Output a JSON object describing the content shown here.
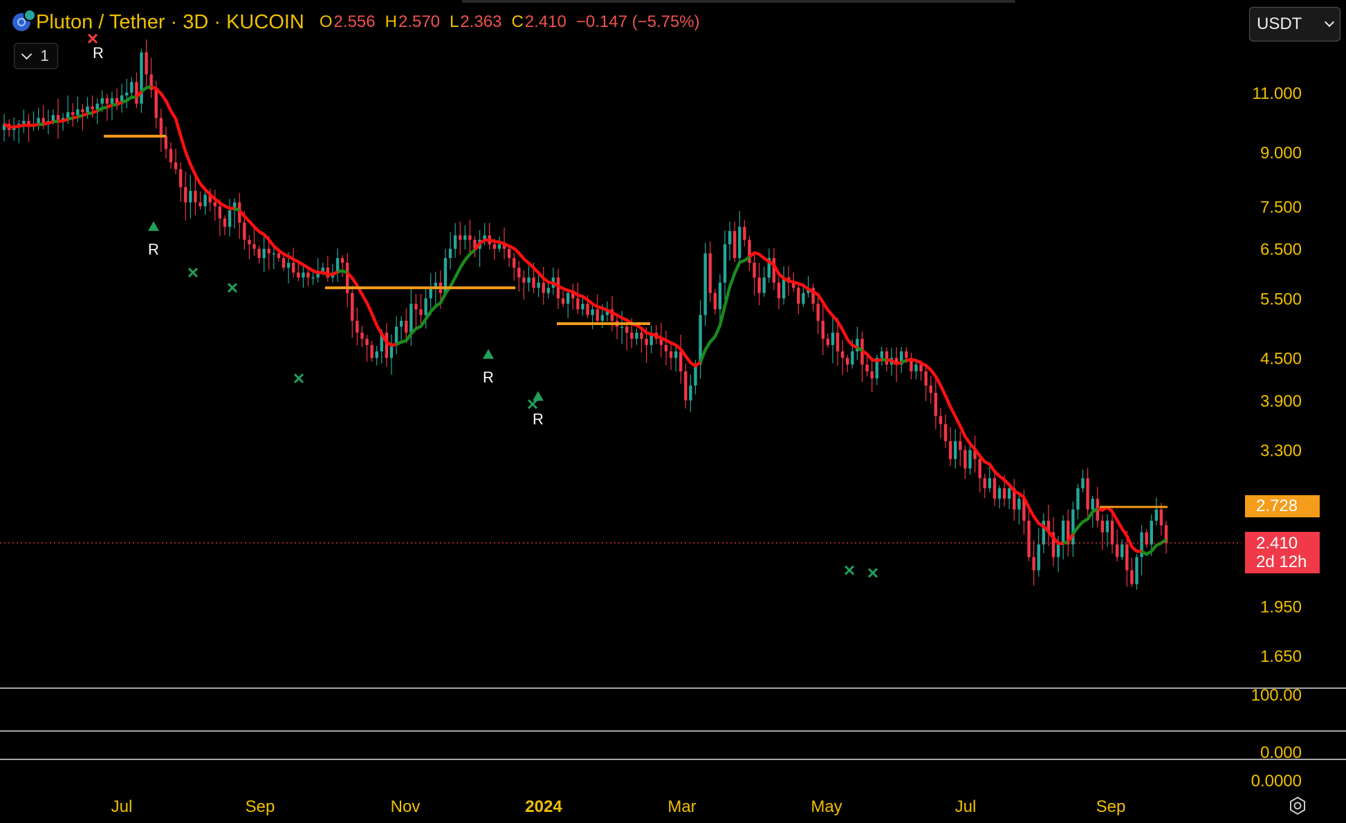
{
  "header": {
    "title": "Pluton / Tether · 3D · KUCOIN",
    "ohlc": [
      {
        "key": "O",
        "value": "2.556"
      },
      {
        "key": "H",
        "value": "2.570"
      },
      {
        "key": "L",
        "value": "2.363"
      },
      {
        "key": "C",
        "value": "2.410"
      }
    ],
    "change": "−0.147 (−5.75%)",
    "collapse_count": "1"
  },
  "currency_select": "USDT",
  "tags": {
    "orange_value": "2.728",
    "last_price": "2.410",
    "countdown": "2d 12h"
  },
  "colors": {
    "up": "#26a69a",
    "down": "#f23645",
    "ma_red": "#ff1010",
    "ma_green": "#1b8a1b",
    "ma_orange": "#f59c1a",
    "axis_text": "#f0c000"
  },
  "chart_data": {
    "type": "candlestick",
    "title": "Pluton / Tether · 3D · KUCOIN",
    "price_axis_scale": "log",
    "price_ticks": [
      11.0,
      9.0,
      7.5,
      6.5,
      5.5,
      4.5,
      3.9,
      3.3,
      1.95,
      1.65
    ],
    "price_tick_labels": [
      "11.000",
      "9.000",
      "7.500",
      "6.500",
      "5.500",
      "4.500",
      "3.900",
      "3.300",
      "1.950",
      "1.650"
    ],
    "indicator_tick_labels": [
      "100.00",
      "0.000",
      "0.0000"
    ],
    "x_labels": [
      "Jul",
      "Sep",
      "Nov",
      "2024",
      "Mar",
      "May",
      "Jul",
      "Sep"
    ],
    "last_price": 2.41,
    "resistance_level": 2.728,
    "closes": [
      9.9,
      9.7,
      9.8,
      9.9,
      10.0,
      9.8,
      9.9,
      10.1,
      9.9,
      10.0,
      10.2,
      10.0,
      10.1,
      10.3,
      10.2,
      10.4,
      10.3,
      10.5,
      10.4,
      10.6,
      10.8,
      10.6,
      10.8,
      10.6,
      10.9,
      11.0,
      11.4,
      10.6,
      12.6,
      11.7,
      11.1,
      10.1,
      9.5,
      9.1,
      8.7,
      8.5,
      8.0,
      7.6,
      7.9,
      7.6,
      7.5,
      7.8,
      7.6,
      7.5,
      7.2,
      7.0,
      7.4,
      7.6,
      7.1,
      6.7,
      6.6,
      6.5,
      6.3,
      6.5,
      6.4,
      6.4,
      6.3,
      6.1,
      6.2,
      6.0,
      5.9,
      6.0,
      5.9,
      5.9,
      6.0,
      6.1,
      5.9,
      6.0,
      6.3,
      6.2,
      5.6,
      5.1,
      4.9,
      4.8,
      4.7,
      4.5,
      4.6,
      4.9,
      4.5,
      4.7,
      5.0,
      5.1,
      4.9,
      5.4,
      5.3,
      5.2,
      5.5,
      5.7,
      5.8,
      5.6,
      6.3,
      6.5,
      6.8,
      6.7,
      6.8,
      6.7,
      6.5,
      6.7,
      6.8,
      6.6,
      6.5,
      6.6,
      6.5,
      6.3,
      6.1,
      5.9,
      5.8,
      5.9,
      5.7,
      5.8,
      5.6,
      5.7,
      5.9,
      5.5,
      5.4,
      5.6,
      5.5,
      5.3,
      5.4,
      5.2,
      5.3,
      5.1,
      5.2,
      5.3,
      5.1,
      5.0,
      5.0,
      4.9,
      4.8,
      4.9,
      4.8,
      4.7,
      4.9,
      4.8,
      4.7,
      4.6,
      4.5,
      4.6,
      4.3,
      3.9,
      4.1,
      4.4,
      5.2,
      6.4,
      5.6,
      5.3,
      5.8,
      6.6,
      6.9,
      6.3,
      7.0,
      6.7,
      6.2,
      5.9,
      5.6,
      5.9,
      6.3,
      5.8,
      5.5,
      5.9,
      5.8,
      5.7,
      5.4,
      5.6,
      5.7,
      5.4,
      5.1,
      4.8,
      4.7,
      4.9,
      4.6,
      4.5,
      4.4,
      4.6,
      4.8,
      4.4,
      4.3,
      4.2,
      4.5,
      4.6,
      4.4,
      4.5,
      4.4,
      4.6,
      4.5,
      4.3,
      4.4,
      4.3,
      4.1,
      4.0,
      3.7,
      3.6,
      3.4,
      3.2,
      3.4,
      3.3,
      3.1,
      3.3,
      3.2,
      3.0,
      2.9,
      3.0,
      2.8,
      2.9,
      2.8,
      2.9,
      2.7,
      2.8,
      2.6,
      2.3,
      2.2,
      2.4,
      2.6,
      2.5,
      2.3,
      2.4,
      2.6,
      2.4,
      2.7,
      2.9,
      3.0,
      2.7,
      2.8,
      2.6,
      2.5,
      2.6,
      2.4,
      2.3,
      2.4,
      2.2,
      2.1,
      2.3,
      2.5,
      2.4,
      2.6,
      2.7,
      2.56,
      2.41
    ],
    "signals": [
      {
        "type": "sell-cross",
        "label": "R",
        "price": 13.2
      },
      {
        "type": "buy-triangle",
        "label": "R",
        "price": 7.0
      },
      {
        "type": "cross",
        "price": 6.0
      },
      {
        "type": "cross",
        "price": 5.7
      },
      {
        "type": "cross",
        "price": 4.2
      },
      {
        "type": "buy-triangle",
        "label": "R",
        "price": 4.55
      },
      {
        "type": "cross",
        "price": 3.85
      },
      {
        "type": "buy-triangle",
        "label": "R",
        "price": 3.95
      },
      {
        "type": "cross",
        "price": 2.2
      },
      {
        "type": "cross",
        "price": 2.18
      }
    ]
  }
}
